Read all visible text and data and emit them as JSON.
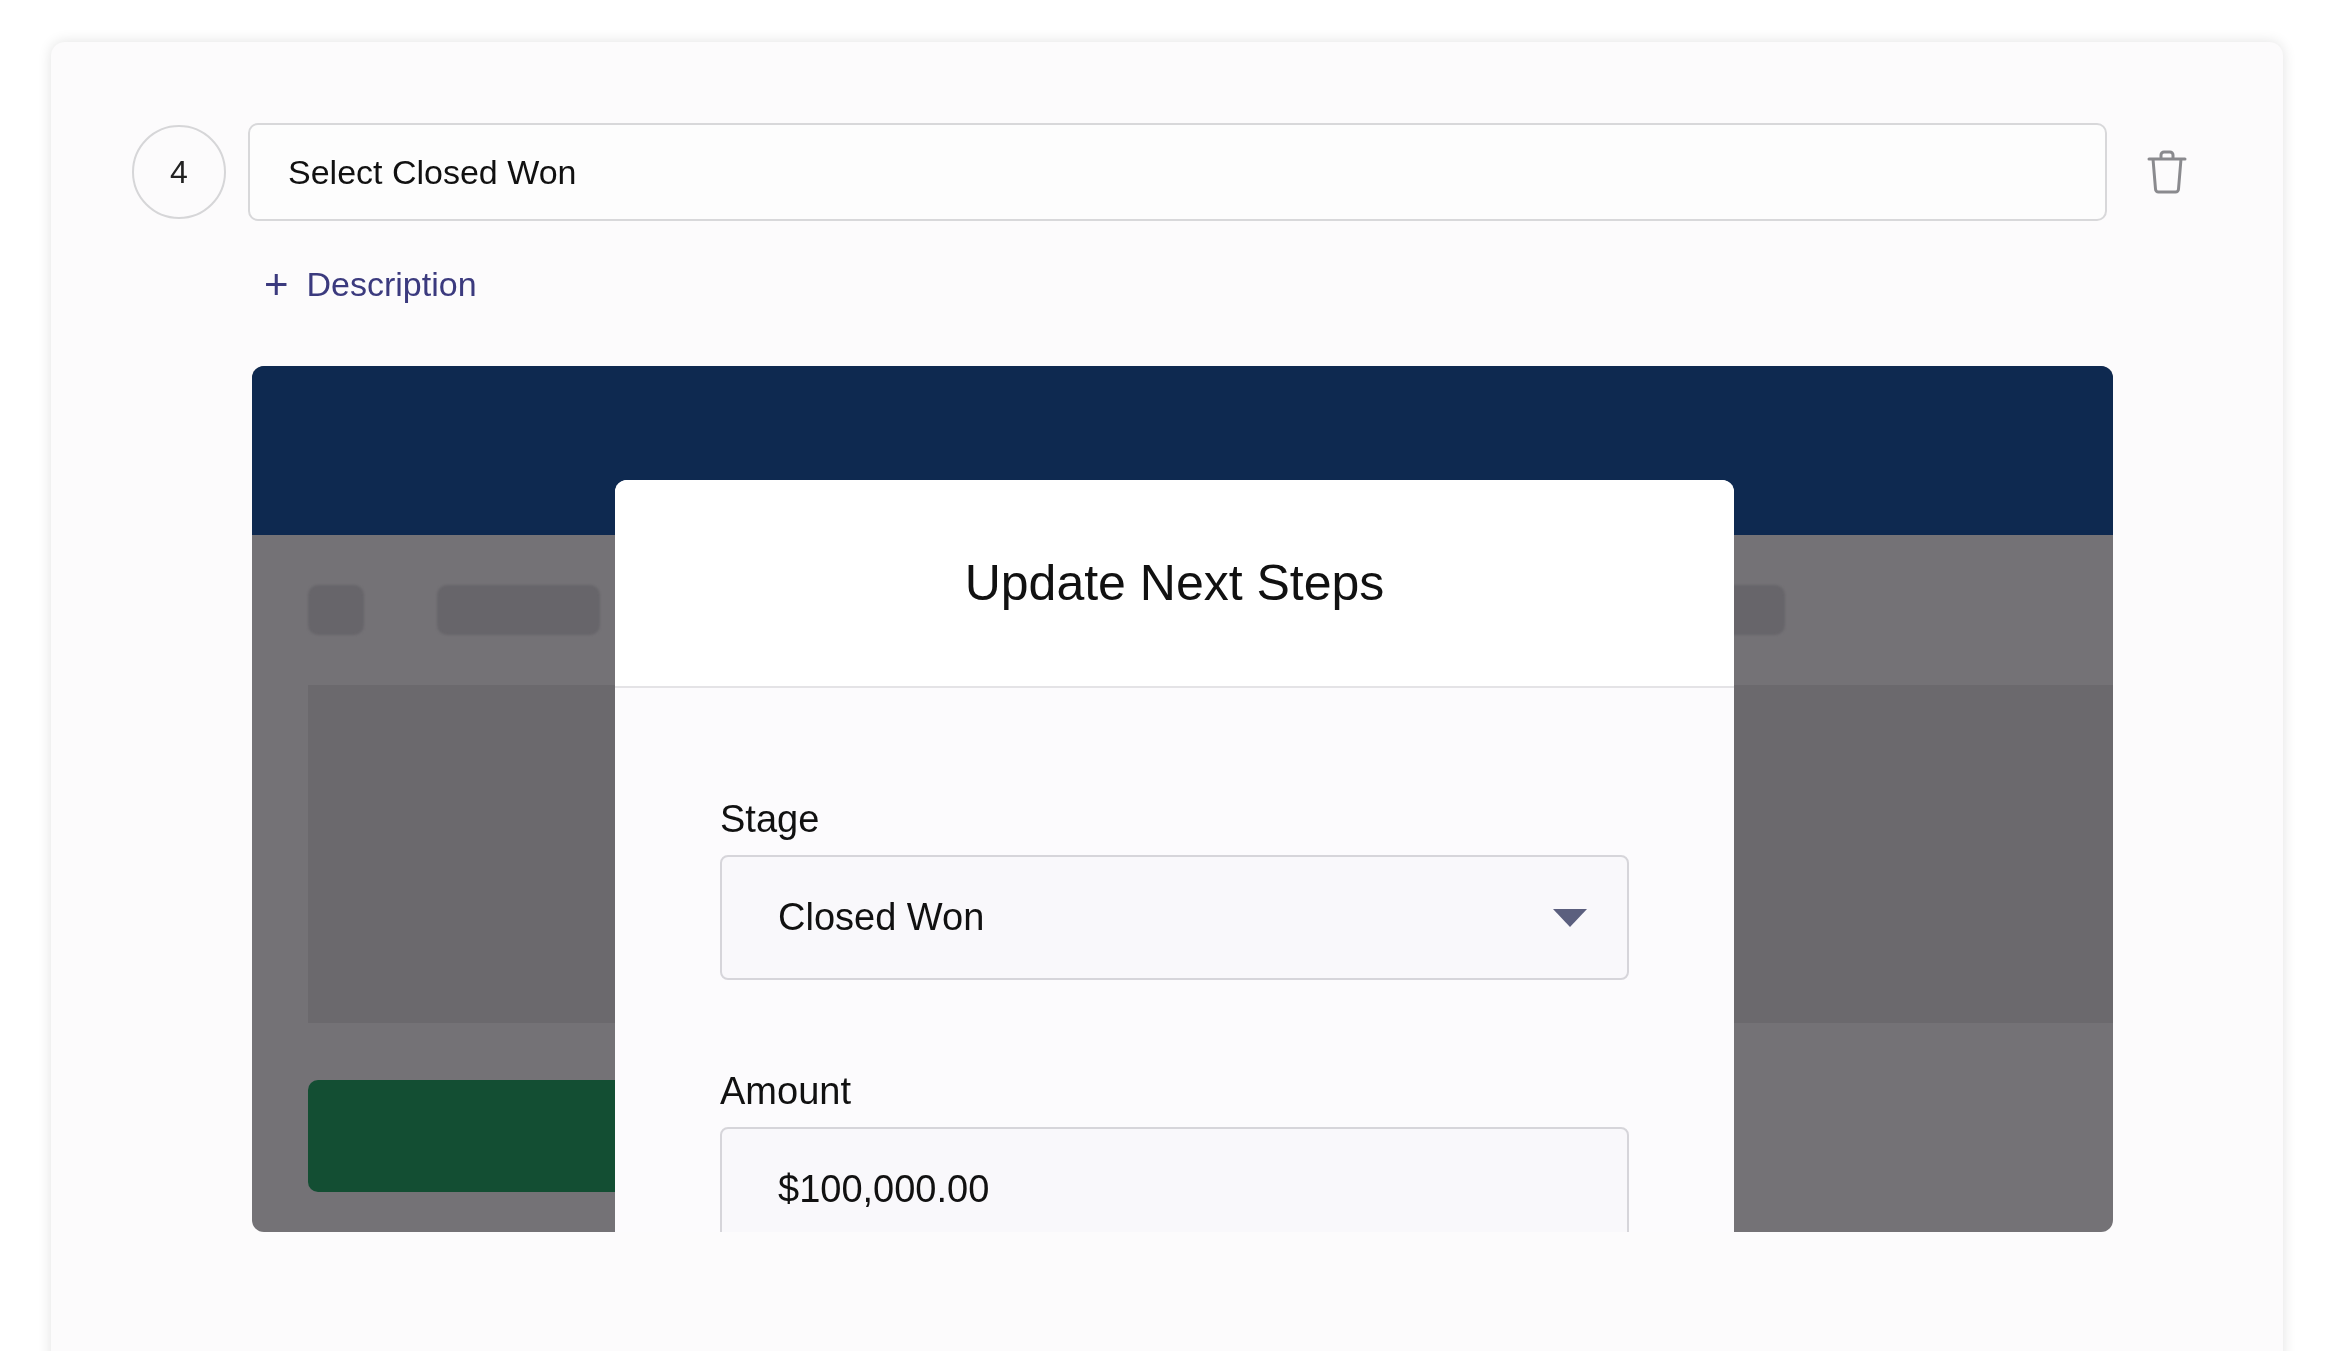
{
  "step": {
    "number": "4",
    "title": "Select Closed Won"
  },
  "add_description": {
    "icon": "+",
    "label": "Description"
  },
  "screenshot": {
    "modal": {
      "title": "Update Next Steps",
      "fields": [
        {
          "kind": "select",
          "label": "Stage",
          "value": "Closed Won"
        },
        {
          "kind": "text",
          "label": "Amount",
          "value": "$100,000.00"
        }
      ]
    }
  }
}
